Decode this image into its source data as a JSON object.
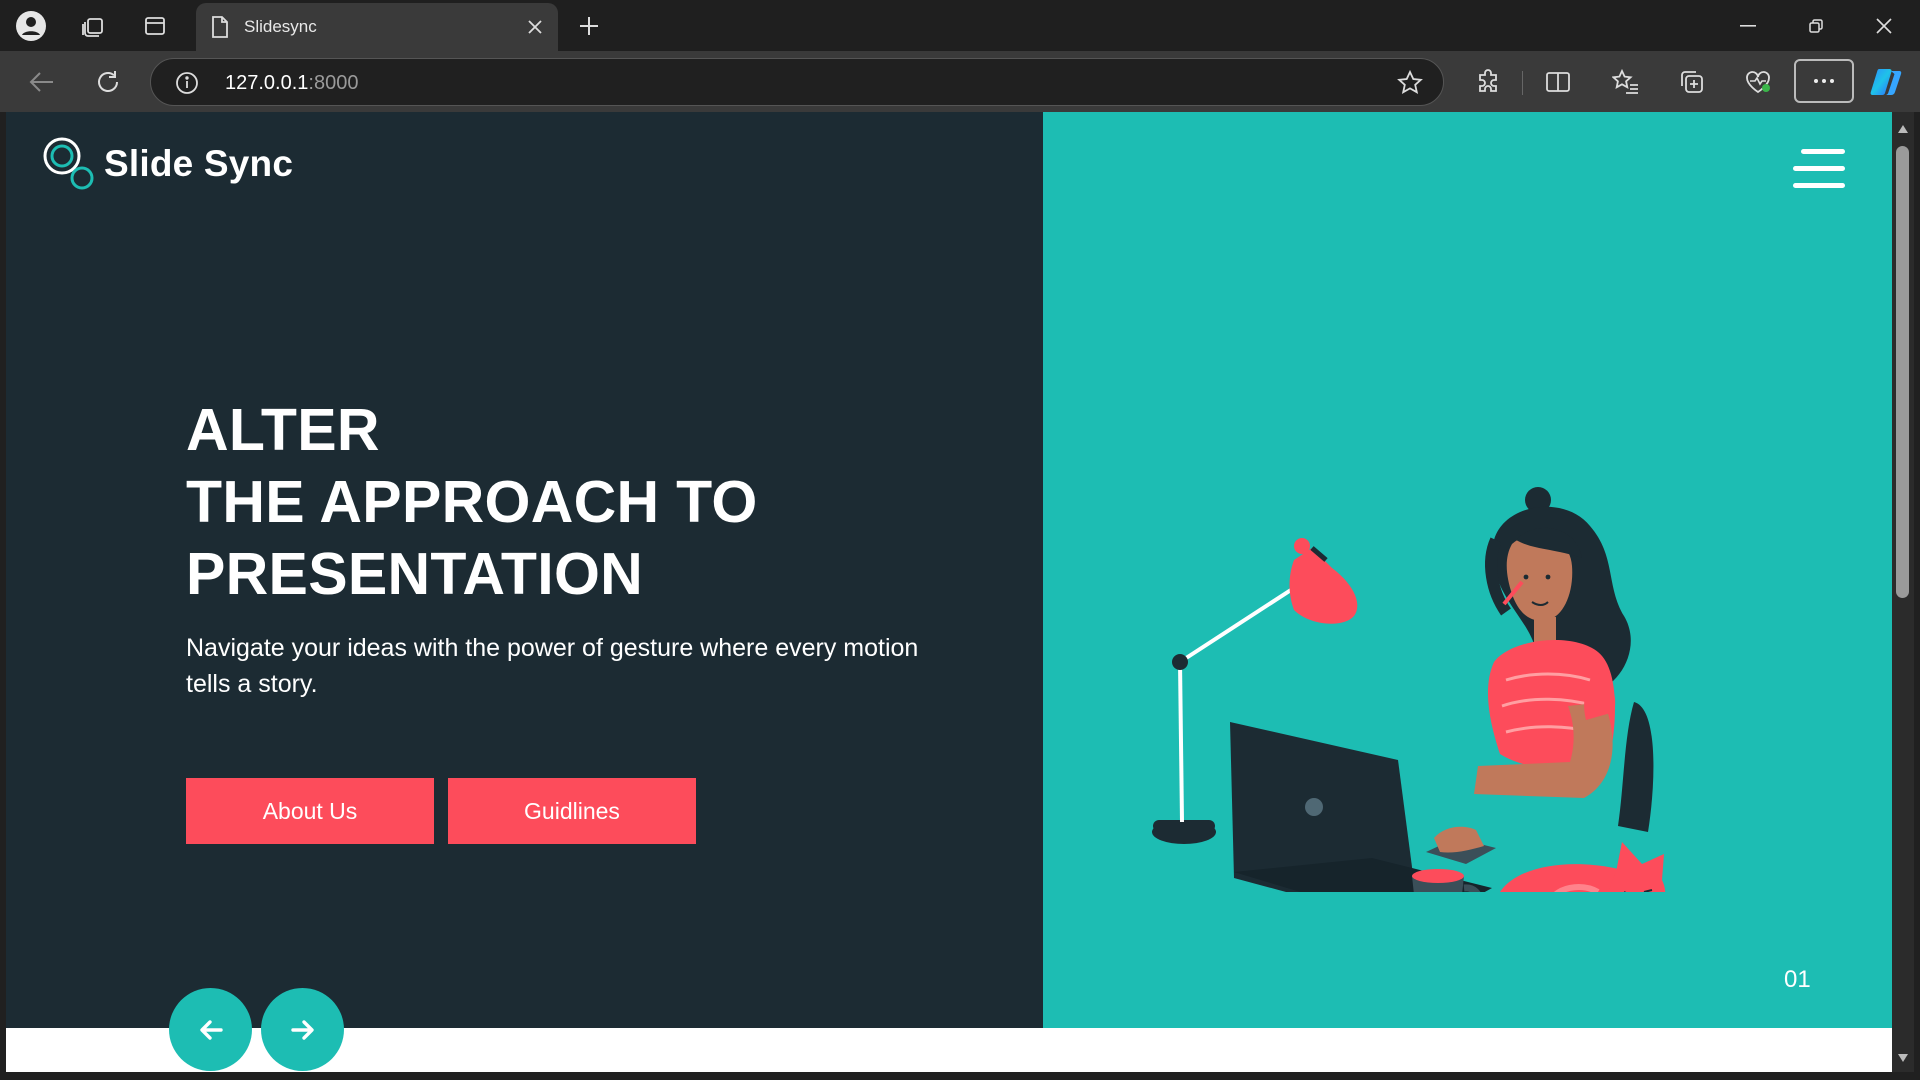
{
  "browser": {
    "tab_title": "Slidesync",
    "url_host": "127.0.0.1",
    "url_port": ":8000"
  },
  "site": {
    "brand": "Slide Sync",
    "hero_lines": [
      "ALTER",
      "THE APPROACH TO",
      "PRESENTATION"
    ],
    "subtitle": "Navigate your ideas with the power of gesture where every motion tells a story.",
    "buttons": {
      "about": "About Us",
      "guidelines": "Guidlines"
    },
    "slide_number": "01"
  },
  "colors": {
    "dark_panel": "#1c2b33",
    "teal": "#1dbdb3",
    "coral": "#fd4c5b",
    "white": "#ffffff"
  },
  "icons": {
    "profile": "profile-icon",
    "workspaces": "workspaces-icon",
    "tab_actions": "tab-actions-icon",
    "page": "page-icon",
    "close": "close-icon",
    "add": "add-icon",
    "back": "back-arrow-icon",
    "reload": "reload-icon",
    "info": "info-icon",
    "star": "star-icon",
    "extensions": "puzzle-icon",
    "split": "split-screen-icon",
    "favorites": "favorites-icon",
    "collections": "collections-icon",
    "health": "browser-essentials-icon",
    "more": "more-icon",
    "copilot": "copilot-icon",
    "menu": "hamburger-menu-icon",
    "prev": "arrow-left-icon",
    "next": "arrow-right-icon"
  }
}
